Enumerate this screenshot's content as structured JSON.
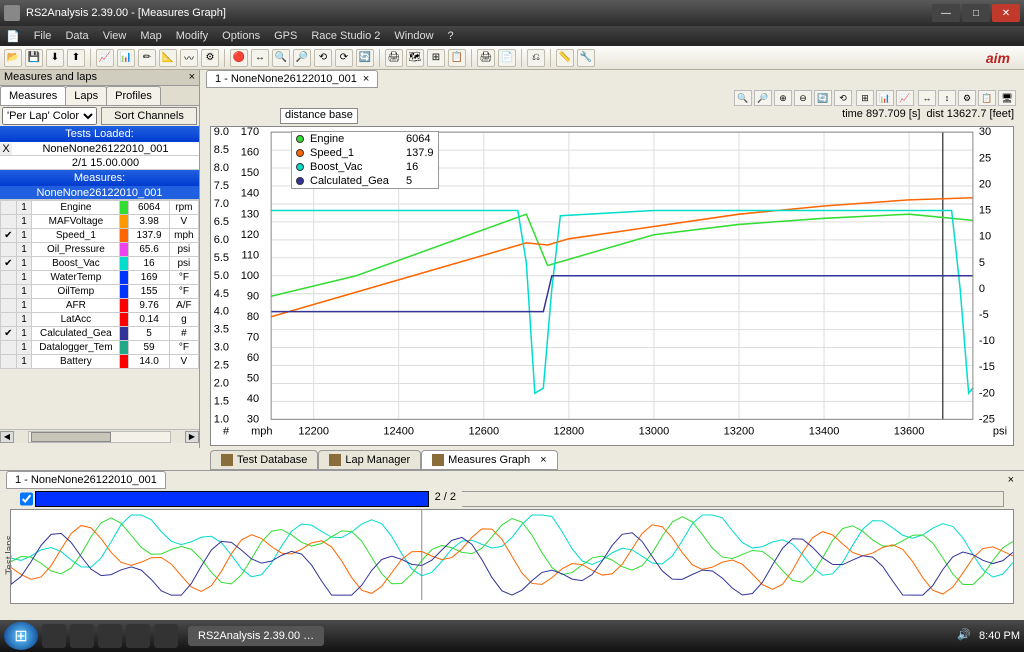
{
  "title": "RS2Analysis 2.39.00 - [Measures Graph]",
  "menu": [
    "File",
    "Data",
    "View",
    "Map",
    "Modify",
    "Options",
    "GPS",
    "Race Studio 2",
    "Window",
    "?"
  ],
  "logo": "aim",
  "sidebar": {
    "title": "Measures and laps",
    "tabs": [
      "Measures",
      "Laps",
      "Profiles"
    ],
    "perlap": "'Per Lap' Color",
    "sort": "Sort Channels",
    "tests_loaded": "Tests Loaded:",
    "test_name": "NoneNone26122010_001",
    "lap": "2/1 15.00.000",
    "measures_hdr": "Measures:",
    "measures_sub": "NoneNone26122010_001",
    "rows": [
      {
        "chk": "",
        "n": "1",
        "name": "Engine",
        "color": "#33dd33",
        "val": "6064",
        "unit": "rpm"
      },
      {
        "chk": "",
        "n": "1",
        "name": "MAFVoltage",
        "color": "#ff9900",
        "val": "3.98",
        "unit": "V"
      },
      {
        "chk": "✔",
        "n": "1",
        "name": "Speed_1",
        "color": "#ff6600",
        "val": "137.9",
        "unit": "mph"
      },
      {
        "chk": "",
        "n": "1",
        "name": "Oil_Pressure",
        "color": "#ee44ee",
        "val": "65.6",
        "unit": "psi"
      },
      {
        "chk": "✔",
        "n": "1",
        "name": "Boost_Vac",
        "color": "#00ddcc",
        "val": "16",
        "unit": "psi"
      },
      {
        "chk": "",
        "n": "1",
        "name": "WaterTemp",
        "color": "#0033ff",
        "val": "169",
        "unit": "°F"
      },
      {
        "chk": "",
        "n": "1",
        "name": "OilTemp",
        "color": "#0033ff",
        "val": "155",
        "unit": "°F"
      },
      {
        "chk": "",
        "n": "1",
        "name": "AFR",
        "color": "#ff0000",
        "val": "9.76",
        "unit": "A/F"
      },
      {
        "chk": "",
        "n": "1",
        "name": "LatAcc",
        "color": "#ff0000",
        "val": "0.14",
        "unit": "g"
      },
      {
        "chk": "✔",
        "n": "1",
        "name": "Calculated_Gea",
        "color": "#333399",
        "val": "5",
        "unit": "#"
      },
      {
        "chk": "",
        "n": "1",
        "name": "Datalogger_Tem",
        "color": "#2a8",
        "val": "59",
        "unit": "°F"
      },
      {
        "chk": "",
        "n": "1",
        "name": "Battery",
        "color": "#ff0000",
        "val": "14.0",
        "unit": "V"
      }
    ]
  },
  "graph": {
    "tab": "1 - NoneNone26122010_001",
    "distance_base": "distance base",
    "info_time": "time 897.709 [s]",
    "info_dist": "dist 13627.7 [feet]",
    "legend": [
      {
        "name": "Engine",
        "color": "#33dd33",
        "val": "6064"
      },
      {
        "name": "Speed_1",
        "color": "#ff6600",
        "val": "137.9"
      },
      {
        "name": "Boost_Vac",
        "color": "#00ddcc",
        "val": "16"
      },
      {
        "name": "Calculated_Gea",
        "color": "#333399",
        "val": "5"
      }
    ],
    "y1_label": "#",
    "y2_label": "mph",
    "y3_label": "psi"
  },
  "chart_data": {
    "type": "line",
    "x_range": [
      12100,
      13750
    ],
    "x_ticks": [
      12200,
      12400,
      12600,
      12800,
      13000,
      13200,
      13400,
      13600
    ],
    "y_left1": {
      "label": "#",
      "range": [
        1.0,
        9.0
      ],
      "ticks": [
        1.0,
        1.5,
        2.0,
        2.5,
        3.0,
        3.5,
        4.0,
        4.5,
        5.0,
        5.5,
        6.0,
        6.5,
        7.0,
        7.5,
        8.0,
        8.5,
        9.0
      ]
    },
    "y_left2": {
      "label": "mph",
      "range": [
        30,
        170
      ],
      "ticks": [
        30,
        40,
        50,
        60,
        70,
        80,
        90,
        100,
        110,
        120,
        130,
        140,
        150,
        160,
        170
      ]
    },
    "y_right": {
      "label": "psi",
      "range": [
        -25,
        30
      ],
      "ticks": [
        -25,
        -20,
        -15,
        -10,
        -5,
        0,
        5,
        10,
        15,
        20,
        25,
        30
      ]
    },
    "series": [
      {
        "name": "Engine",
        "color": "#33dd33",
        "axis": "y_left1?",
        "approx_values": [
          [
            12100,
            90
          ],
          [
            12300,
            100
          ],
          [
            12500,
            115
          ],
          [
            12700,
            130
          ],
          [
            12750,
            105
          ],
          [
            12800,
            108
          ],
          [
            13000,
            120
          ],
          [
            13200,
            125
          ],
          [
            13400,
            128
          ],
          [
            13600,
            130
          ],
          [
            13750,
            127
          ]
        ]
      },
      {
        "name": "Speed_1",
        "color": "#ff6600",
        "axis": "mph",
        "approx_values": [
          [
            12100,
            80
          ],
          [
            12300,
            92
          ],
          [
            12500,
            104
          ],
          [
            12700,
            116
          ],
          [
            12750,
            115
          ],
          [
            12800,
            118
          ],
          [
            13000,
            124
          ],
          [
            13200,
            130
          ],
          [
            13400,
            134
          ],
          [
            13600,
            137
          ],
          [
            13750,
            138
          ]
        ]
      },
      {
        "name": "Boost_Vac",
        "color": "#00ddcc",
        "axis": "psi",
        "approx_values": [
          [
            12100,
            15
          ],
          [
            12300,
            15
          ],
          [
            12500,
            15
          ],
          [
            12680,
            15
          ],
          [
            12700,
            5
          ],
          [
            12720,
            -20
          ],
          [
            12740,
            -19
          ],
          [
            12760,
            0
          ],
          [
            12780,
            14
          ],
          [
            13000,
            15
          ],
          [
            13400,
            15
          ],
          [
            13700,
            15
          ],
          [
            13720,
            0
          ],
          [
            13740,
            -20
          ],
          [
            13750,
            -19
          ]
        ]
      },
      {
        "name": "Calculated_Gea",
        "color": "#333399",
        "axis": "#",
        "approx_values": [
          [
            12100,
            4
          ],
          [
            12740,
            4
          ],
          [
            12760,
            5
          ],
          [
            13750,
            5
          ]
        ]
      }
    ]
  },
  "bottom_tabs": [
    {
      "label": "Test Database"
    },
    {
      "label": "Lap Manager"
    },
    {
      "label": "Measures Graph",
      "active": true
    }
  ],
  "secondary": {
    "tab": "1 - NoneNone26122010_001",
    "lap_label": "2 / 2",
    "side_label": "Test laps"
  },
  "taskbar": {
    "app": "RS2Analysis 2.39.00 …",
    "time": "8:40 PM"
  }
}
